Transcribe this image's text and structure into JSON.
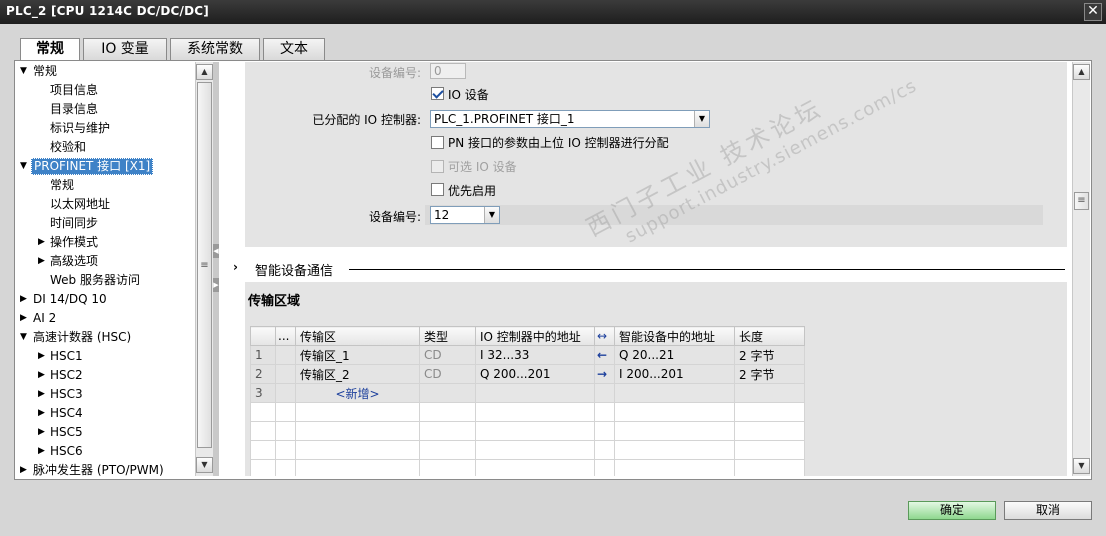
{
  "window": {
    "title": "PLC_2 [CPU 1214C DC/DC/DC]",
    "close_glyph": "✕"
  },
  "tabs": [
    {
      "label": "常规",
      "active": true
    },
    {
      "label": "IO 变量",
      "active": false
    },
    {
      "label": "系统常数",
      "active": false
    },
    {
      "label": "文本",
      "active": false
    }
  ],
  "nav": {
    "items": [
      {
        "label": "常规",
        "arrow": "▼",
        "level": 0
      },
      {
        "label": "项目信息",
        "arrow": "",
        "level": 1
      },
      {
        "label": "目录信息",
        "arrow": "",
        "level": 1
      },
      {
        "label": "标识与维护",
        "arrow": "",
        "level": 1
      },
      {
        "label": "校验和",
        "arrow": "",
        "level": 1
      },
      {
        "label": "PROFINET 接口 [X1]",
        "arrow": "▼",
        "level": 0,
        "selected": true
      },
      {
        "label": "常规",
        "arrow": "",
        "level": 1
      },
      {
        "label": "以太网地址",
        "arrow": "",
        "level": 1
      },
      {
        "label": "时间同步",
        "arrow": "",
        "level": 1
      },
      {
        "label": "操作模式",
        "arrow": "▶",
        "level": 1
      },
      {
        "label": "高级选项",
        "arrow": "▶",
        "level": 1
      },
      {
        "label": "Web 服务器访问",
        "arrow": "",
        "level": 1
      },
      {
        "label": "DI 14/DQ 10",
        "arrow": "▶",
        "level": 0
      },
      {
        "label": "AI 2",
        "arrow": "▶",
        "level": 0
      },
      {
        "label": "高速计数器 (HSC)",
        "arrow": "▼",
        "level": 0
      },
      {
        "label": "HSC1",
        "arrow": "▶",
        "level": 1
      },
      {
        "label": "HSC2",
        "arrow": "▶",
        "level": 1
      },
      {
        "label": "HSC3",
        "arrow": "▶",
        "level": 1
      },
      {
        "label": "HSC4",
        "arrow": "▶",
        "level": 1
      },
      {
        "label": "HSC5",
        "arrow": "▶",
        "level": 1
      },
      {
        "label": "HSC6",
        "arrow": "▶",
        "level": 1
      },
      {
        "label": "脉冲发生器 (PTO/PWM)",
        "arrow": "▶",
        "level": 0
      }
    ]
  },
  "io_device": {
    "device_number_top_label": "设备编号:",
    "device_number_top_value": "0",
    "io_device_label": "IO 设备",
    "io_device_checked": true,
    "assigned_controller_label": "已分配的 IO 控制器:",
    "assigned_controller_value": "PLC_1.PROFINET 接口_1",
    "pn_params_label": "PN 接口的参数由上位 IO 控制器进行分配",
    "optional_device_label": "可选 IO 设备",
    "priority_startup_label": "优先启用",
    "device_number_label": "设备编号:",
    "device_number_value": "12"
  },
  "smart_device": {
    "section_title": "智能设备通信",
    "section_arrow": "›",
    "transfer_title": "传输区域",
    "columns": [
      "...",
      "传输区",
      "类型",
      "IO 控制器中的地址",
      "↔",
      "智能设备中的地址",
      "长度"
    ],
    "rows": [
      {
        "no": "1",
        "name": "传输区_1",
        "type": "CD",
        "ctrl_addr": "I 32...33",
        "dir": "←",
        "dev_addr": "Q 20...21",
        "len": "2 字节"
      },
      {
        "no": "2",
        "name": "传输区_2",
        "type": "CD",
        "ctrl_addr": "Q 200...201",
        "dir": "→",
        "dev_addr": "I 200...201",
        "len": "2 字节"
      }
    ],
    "add_row_no": "3",
    "add_label": "<新增>"
  },
  "watermark": {
    "line1": "西门子工业 技术论坛",
    "line2": "support.industry.siemens.com/cs"
  },
  "footer": {
    "ok_label": "确定",
    "cancel_label": "取消"
  },
  "colors": {
    "selection": "#3e82c7",
    "ok_button": "#8fd78f"
  }
}
